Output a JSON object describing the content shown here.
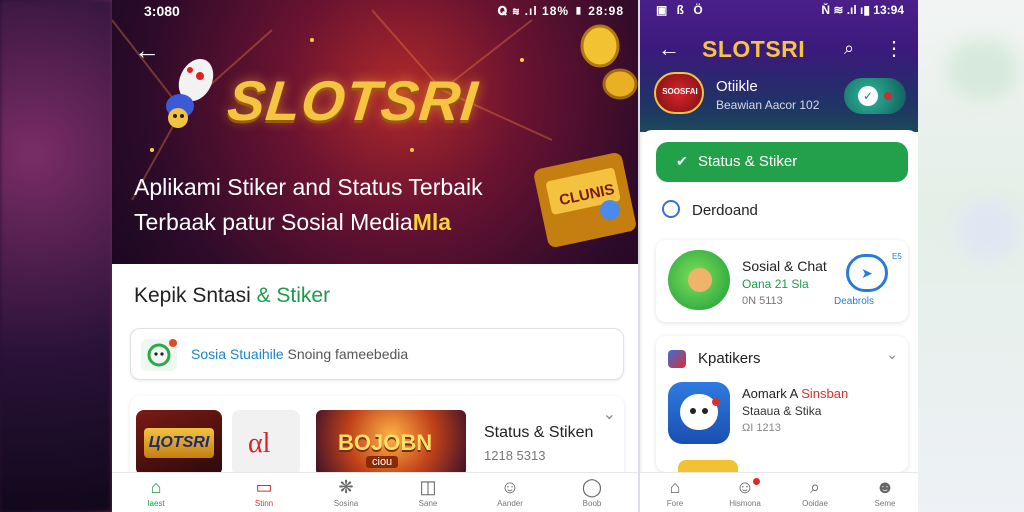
{
  "left": {
    "status": {
      "time": "3:080",
      "icons": "𝐐 ≋ .ıl 18% ▮ 28:98"
    },
    "hero": {
      "logo": "SLOTSRI",
      "title_line1": "Aplikami Stiker and Status Terbaik",
      "title_line2_a": "Terbaak patur Sosial Media",
      "title_line2_b": "Mla"
    },
    "section_title_a": "Kepik Sntasi ",
    "section_title_b": "& Stiker",
    "search": {
      "blue": "Sosia Stuaihile",
      "rest": " Snoing fameebedia"
    },
    "card": {
      "thumb1": "ЦОТSRI",
      "thumb2": "αl",
      "thumb3": "BOJOBN",
      "thumb3_sub": "ciou",
      "title": "Status & Stiken",
      "sub": "1218 5313"
    },
    "nav": [
      {
        "label": "Iaest",
        "icon": "⌂"
      },
      {
        "label": "Stinn",
        "icon": "▭"
      },
      {
        "label": "Sosina",
        "icon": "❋"
      },
      {
        "label": "Sane",
        "icon": "◫"
      },
      {
        "label": "Aander",
        "icon": "☺"
      },
      {
        "label": "Boob",
        "icon": "◯"
      }
    ]
  },
  "right": {
    "status": {
      "left": "▣ ß Ö",
      "right": "Ň ≋ .ıl ı▮ 13:94"
    },
    "title": "SLOTSRI",
    "app": {
      "logo": "SOOSFAI",
      "name": "Otiikle",
      "sub": "Beawian Aacor 102"
    },
    "green_button": "Status & Stiker",
    "download_label": "Derdoand",
    "card1": {
      "title": "Sosial & Chat",
      "sub": "Oana 21 Sla",
      "sub2": "0N 5113",
      "dl_label": "Deabrols",
      "num": "E5"
    },
    "card2": {
      "header": "Kpatikers",
      "title_a": "Aomark A ",
      "title_b": "Sinsban",
      "sub": "Staaua & Stika",
      "sub2": "ΩI 1213"
    },
    "nav": [
      {
        "label": "Fore",
        "icon": "⌂"
      },
      {
        "label": "Hismona",
        "icon": "☺"
      },
      {
        "label": "Ooidae",
        "icon": "⌕"
      },
      {
        "label": "Seme",
        "icon": "☻"
      }
    ]
  },
  "colors": {
    "accent_green": "#23a14a",
    "brand_gold": "#f5c542",
    "alert_red": "#d83030"
  }
}
